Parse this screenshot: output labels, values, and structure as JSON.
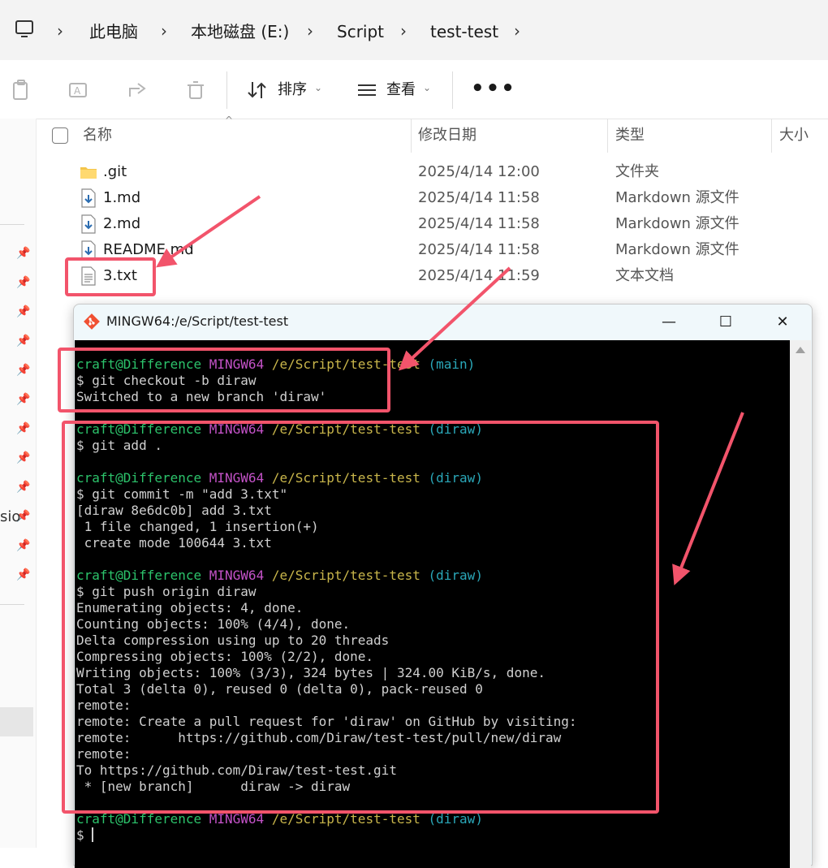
{
  "breadcrumb": {
    "items": [
      "此电脑",
      "本地磁盘 (E:)",
      "Script",
      "test-test"
    ]
  },
  "toolbar": {
    "sort_label": "排序",
    "view_label": "查看",
    "more_label": "•••",
    "icons": [
      "paste-icon",
      "rename-icon",
      "share-icon",
      "delete-icon",
      "sort-icon",
      "view-icon"
    ]
  },
  "nav": {
    "truncated_label": "sio"
  },
  "file_list": {
    "columns": [
      "名称",
      "修改日期",
      "类型",
      "大小"
    ],
    "rows": [
      {
        "name": ".git",
        "date": "2025/4/14 12:00",
        "type": "文件夹",
        "icon": "folder-icon"
      },
      {
        "name": "1.md",
        "date": "2025/4/14 11:58",
        "type": "Markdown 源文件",
        "icon": "markdown-file-icon"
      },
      {
        "name": "2.md",
        "date": "2025/4/14 11:58",
        "type": "Markdown 源文件",
        "icon": "markdown-file-icon"
      },
      {
        "name": "README.md",
        "date": "2025/4/14 11:58",
        "type": "Markdown 源文件",
        "icon": "markdown-file-icon"
      },
      {
        "name": "3.txt",
        "date": "2025/4/14 11:59",
        "type": "文本文档",
        "icon": "text-file-icon"
      }
    ]
  },
  "terminal": {
    "title": "MINGW64:/e/Script/test-test",
    "controls": {
      "minimize": "—",
      "maximize": "☐",
      "close": "✕"
    },
    "prompt": {
      "user": "craft@Difference",
      "system": "MINGW64",
      "path": "/e/Script/test-test",
      "branch_main": "(main)",
      "branch_diraw": "(diraw)"
    },
    "cmd1": "$ git checkout -b diraw",
    "out1": [
      "Switched to a new branch 'diraw'"
    ],
    "cmd2": "$ git add .",
    "cmd3": "$ git commit -m \"add 3.txt\"",
    "out3": [
      "[diraw 8e6dc0b] add 3.txt",
      " 1 file changed, 1 insertion(+)",
      " create mode 100644 3.txt"
    ],
    "cmd4": "$ git push origin diraw",
    "out4": [
      "Enumerating objects: 4, done.",
      "Counting objects: 100% (4/4), done.",
      "Delta compression using up to 20 threads",
      "Compressing objects: 100% (2/2), done.",
      "Writing objects: 100% (3/3), 324 bytes | 324.00 KiB/s, done.",
      "Total 3 (delta 0), reused 0 (delta 0), pack-reused 0",
      "remote:",
      "remote: Create a pull request for 'diraw' on GitHub by visiting:",
      "remote:      https://github.com/Diraw/test-test/pull/new/diraw",
      "remote:",
      "To https://github.com/Diraw/test-test.git",
      " * [new branch]      diraw -> diraw"
    ],
    "final_prompt": "$ "
  },
  "colors": {
    "highlight": "#f2546b",
    "prompt_user": "#2cc36b",
    "prompt_system": "#c352c7",
    "prompt_path": "#c9b64b",
    "prompt_branch": "#2aa7b8"
  }
}
